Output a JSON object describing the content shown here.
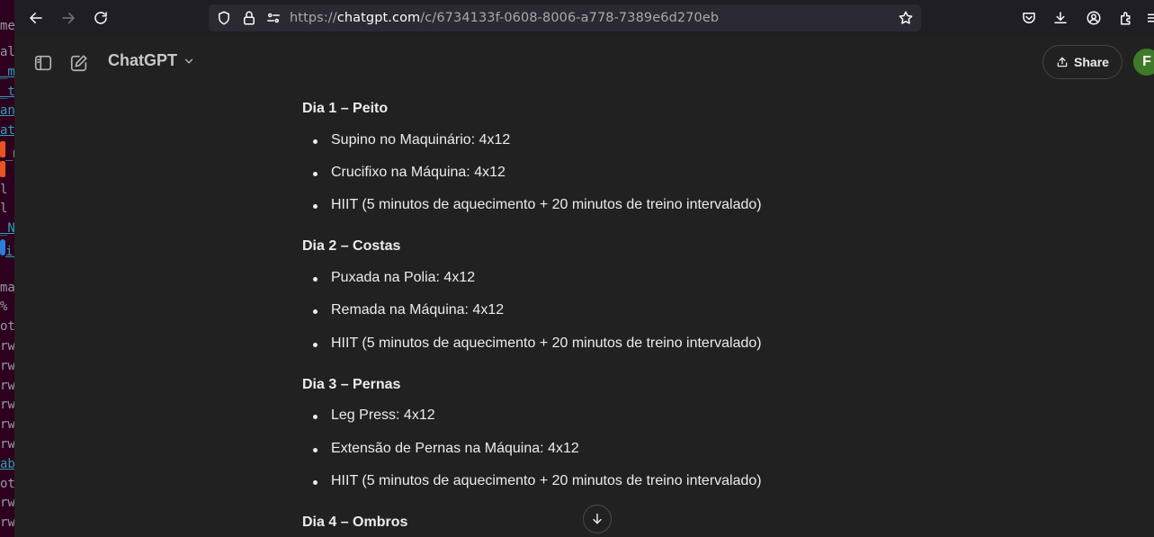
{
  "browser": {
    "url_scheme": "https://",
    "url_host": "chatgpt.com",
    "url_path": "/c/6734133f-0608-8006-a778-7389e6d270eb"
  },
  "terminal_fragment": {
    "lines": [
      "me",
      "al",
      "_m",
      "_t",
      "an",
      "at",
      "_m",
      "",
      "l",
      "l",
      "_N",
      "il",
      "",
      "ma",
      "%",
      "ot",
      "rw",
      "rw",
      "rw",
      "rw",
      "rw",
      "rw",
      "ab",
      "ot",
      "rw",
      "rw"
    ]
  },
  "header": {
    "brand": "ChatGPT",
    "share_label": "Share",
    "avatar_initial": "F"
  },
  "workout": [
    {
      "title": "Dia 1 – Peito",
      "items": [
        "Supino no Maquinário: 4x12",
        "Crucifixo na Máquina: 4x12",
        "HIIT (5 minutos de aquecimento + 20 minutos de treino intervalado)"
      ]
    },
    {
      "title": "Dia 2 – Costas",
      "items": [
        "Puxada na Polia: 4x12",
        "Remada na Máquina: 4x12",
        "HIIT (5 minutos de aquecimento + 20 minutos de treino intervalado)"
      ]
    },
    {
      "title": "Dia 3 – Pernas",
      "items": [
        "Leg Press: 4x12",
        "Extensão de Pernas na Máquina: 4x12",
        "HIIT (5 minutos de aquecimento + 20 minutos de treino intervalado)"
      ]
    },
    {
      "title": "Dia 4 – Ombros",
      "items": []
    }
  ],
  "colors": {
    "background": "#212121",
    "text": "#ececec",
    "avatar": "#3f7a2a",
    "browser_bar": "#1f1e25"
  }
}
